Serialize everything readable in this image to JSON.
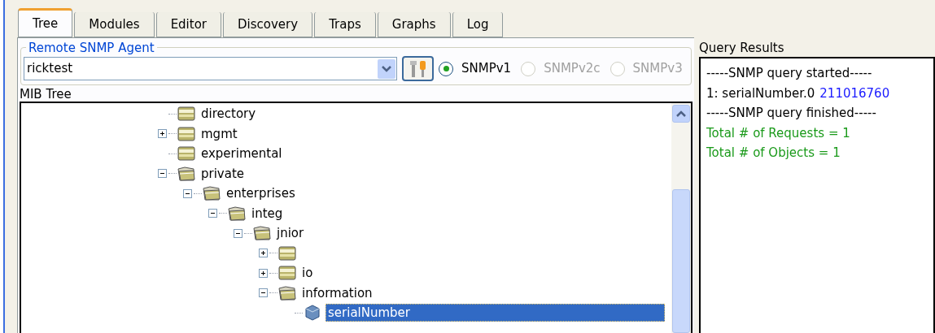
{
  "tabs": [
    {
      "label": "Tree",
      "selected": true
    },
    {
      "label": "Modules",
      "selected": false
    },
    {
      "label": "Editor",
      "selected": false
    },
    {
      "label": "Discovery",
      "selected": false
    },
    {
      "label": "Traps",
      "selected": false
    },
    {
      "label": "Graphs",
      "selected": false
    },
    {
      "label": "Log",
      "selected": false
    }
  ],
  "agent": {
    "legend": "Remote SNMP Agent",
    "host": "ricktest",
    "versions": [
      {
        "label": "SNMPv1",
        "selected": true,
        "disabled": false
      },
      {
        "label": "SNMPv2c",
        "selected": false,
        "disabled": true
      },
      {
        "label": "SNMPv3",
        "selected": false,
        "disabled": true
      }
    ]
  },
  "mib_tree": {
    "title": "MIB Tree",
    "items": [
      {
        "label": "directory",
        "kind": "folder",
        "selected": false
      },
      {
        "label": "mgmt",
        "kind": "folder",
        "expanded": false,
        "selected": false
      },
      {
        "label": "experimental",
        "kind": "folder",
        "selected": false
      },
      {
        "label": "private",
        "kind": "folder",
        "expanded": true,
        "selected": false,
        "children": [
          {
            "label": "enterprises",
            "kind": "folder",
            "expanded": true,
            "selected": false,
            "children": [
              {
                "label": "integ",
                "kind": "folder",
                "expanded": true,
                "selected": false,
                "children": [
                  {
                    "label": "jnior",
                    "kind": "folder",
                    "expanded": true,
                    "selected": false,
                    "children": [
                      {
                        "kind": "folder",
                        "expanded": false,
                        "selected": false
                      },
                      {
                        "label": "io",
                        "kind": "folder",
                        "expanded": false,
                        "selected": false
                      },
                      {
                        "label": "information",
                        "kind": "folder",
                        "expanded": true,
                        "selected": false,
                        "children": [
                          {
                            "label": "serialNumber",
                            "kind": "object",
                            "selected": true
                          }
                        ]
                      }
                    ]
                  }
                ]
              }
            ]
          }
        ]
      }
    ]
  },
  "query_results": {
    "title": "Query Results",
    "lines": [
      {
        "kind": "plain",
        "text": "-----SNMP query started-----"
      },
      {
        "kind": "result",
        "text": "1: serialNumber.0",
        "value": "211016760"
      },
      {
        "kind": "plain",
        "text": "-----SNMP query finished-----"
      },
      {
        "kind": "total",
        "text": "Total # of Requests = 1"
      },
      {
        "kind": "total",
        "text": "Total # of Objects = 1"
      }
    ]
  }
}
